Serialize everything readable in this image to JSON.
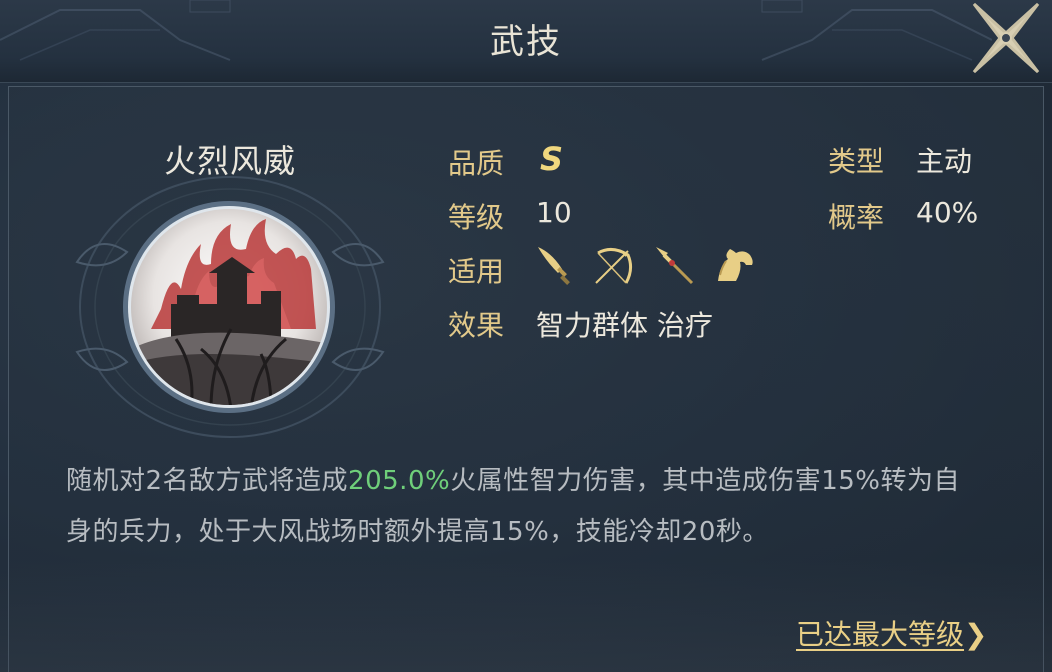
{
  "header": {
    "title": "武技"
  },
  "skill": {
    "name": "火烈风威",
    "icon": "burning-fortress-icon",
    "attrs": {
      "quality_label": "品质",
      "quality_value": "S",
      "level_label": "等级",
      "level_value": "10",
      "applicable_label": "适用",
      "applicable_icons": [
        "sword-icon",
        "bow-icon",
        "spear-icon",
        "horse-icon"
      ],
      "effect_label": "效果",
      "effect_value": "智力群体 治疗",
      "type_label": "类型",
      "type_value": "主动",
      "chance_label": "概率",
      "chance_value": "40%"
    },
    "description": {
      "part1": "随机对2名敌方武将造成",
      "highlight": "205.0%",
      "part2": "火属性智力伤害，其中造成伤害15%转为自身的兵力，处于大风战场时额外提高15%，技能冷却20秒。"
    }
  },
  "footer": {
    "max_level_label": "已达最大等级",
    "arrow": "❯"
  },
  "colors": {
    "gold_label": "#e2c98a",
    "highlight_green": "#6fcf7a",
    "grade_gold": "#f0d77e"
  }
}
